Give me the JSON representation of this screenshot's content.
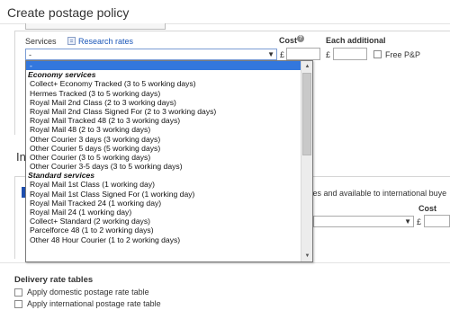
{
  "page": {
    "title": "Create postage policy"
  },
  "services": {
    "label": "Services",
    "research_link": "Research rates",
    "selected_value": "-",
    "dropdown": [
      {
        "kind": "item",
        "label": "-",
        "selected": true
      },
      {
        "kind": "group",
        "label": "Economy services"
      },
      {
        "kind": "item",
        "label": "Collect+ Economy Tracked (3 to 5 working days)"
      },
      {
        "kind": "item",
        "label": "Hermes Tracked (3 to 5 working days)"
      },
      {
        "kind": "item",
        "label": "Royal Mail 2nd Class (2 to 3 working days)"
      },
      {
        "kind": "item",
        "label": "Royal Mail 2nd Class Signed For (2 to 3 working days)"
      },
      {
        "kind": "item",
        "label": "Royal Mail Tracked 48 (2 to 3 working days)"
      },
      {
        "kind": "item",
        "label": "Royal Mail 48 (2 to 3 working days)"
      },
      {
        "kind": "item",
        "label": "Other Courier 3 days (3 working days)"
      },
      {
        "kind": "item",
        "label": "Other Courier 5 days (5 working days)"
      },
      {
        "kind": "item",
        "label": "Other Courier (3 to 5 working days)"
      },
      {
        "kind": "item",
        "label": "Other Courier 3-5 days (3 to 5 working days)"
      },
      {
        "kind": "group",
        "label": "Standard services"
      },
      {
        "kind": "item",
        "label": "Royal Mail 1st Class (1 working day)"
      },
      {
        "kind": "item",
        "label": "Royal Mail 1st Class Signed For (1 working day)"
      },
      {
        "kind": "item",
        "label": "Royal Mail Tracked 24 (1 working day)"
      },
      {
        "kind": "item",
        "label": "Royal Mail 24 (1 working day)"
      },
      {
        "kind": "item",
        "label": "Collect+ Standard (2 working days)"
      },
      {
        "kind": "item",
        "label": "Parcelforce 48 (1 to 2 working days)"
      },
      {
        "kind": "item",
        "label": "Other 48 Hour Courier (1 to 2 working days)"
      }
    ]
  },
  "cost": {
    "label": "Cost",
    "currency": "£",
    "value": ""
  },
  "each_additional": {
    "label": "Each additional",
    "currency": "£",
    "value": ""
  },
  "free_pp": {
    "label": "Free P&P",
    "checked": false
  },
  "international": {
    "heading_fragment": "In",
    "info_fragment": "tes and available to international buye",
    "cost_label": "Cost",
    "currency": "£"
  },
  "delivery_rate_tables": {
    "heading": "Delivery rate tables",
    "options": [
      {
        "label": "Apply domestic postage rate table",
        "checked": false
      },
      {
        "label": "Apply international postage rate table",
        "checked": false
      }
    ]
  },
  "colors": {
    "accent": "#1a56b8",
    "selection": "#3377dd",
    "marker": "#1f4fae"
  }
}
